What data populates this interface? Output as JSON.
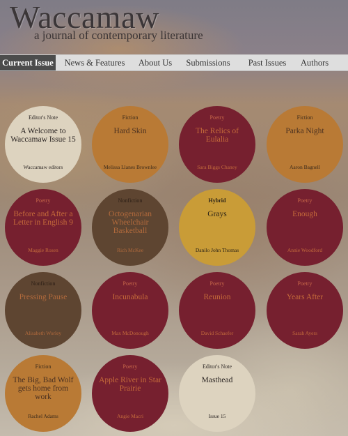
{
  "site": {
    "title": "Waccamaw",
    "tagline": "a journal of contemporary literature"
  },
  "nav": {
    "items": [
      "Current Issue",
      "News & Features",
      "About Us",
      "Submissions",
      "Past Issues",
      "Authors"
    ],
    "active": "Current Issue"
  },
  "colors": {
    "cream": "#ddd3bf",
    "orange": "#b97a35",
    "wine": "#76202f",
    "brown": "#5e4531",
    "mustard": "#c99c37",
    "nav_active": "#4c4c4c"
  },
  "pieces": [
    {
      "category": "Editor's Note",
      "title": "A Welcome to Waccamaw Issue 15",
      "author": "Waccamaw editors",
      "color": "cream"
    },
    {
      "category": "Fiction",
      "title": "Hard Skin",
      "author": "Melissa Llanes Brownlee",
      "color": "orange"
    },
    {
      "category": "Poetry",
      "title": "The Relics of Eulalia",
      "author": "Sara Biggs Chaney",
      "color": "wine"
    },
    {
      "category": "Fiction",
      "title": "Parka Night",
      "author": "Aaron Bagnell",
      "color": "orange"
    },
    {
      "category": "Poetry",
      "title": "Before and After a Letter in English 9",
      "author": "Maggie Rosen",
      "color": "wine"
    },
    {
      "category": "Nonfiction",
      "title": "Octogenarian Wheelchair Basketball",
      "author": "Rich McKee",
      "color": "brown"
    },
    {
      "category": "Hybrid",
      "title": "Grays",
      "author": "Danilo John Thomas",
      "color": "mustard"
    },
    {
      "category": "Poetry",
      "title": "Enough",
      "author": "Annie Woodford",
      "color": "wine"
    },
    {
      "category": "Nonfiction",
      "title": "Pressing Pause",
      "author": "Alisabeth Worley",
      "color": "brown"
    },
    {
      "category": "Poetry",
      "title": "Incunabula",
      "author": "Max McDonough",
      "color": "wine"
    },
    {
      "category": "Poetry",
      "title": "Reunion",
      "author": "David Schaefer",
      "color": "wine"
    },
    {
      "category": "Poetry",
      "title": "Years After",
      "author": "Sarah Ayers",
      "color": "wine"
    },
    {
      "category": "Fiction",
      "title": "The Big, Bad Wolf gets home from work",
      "author": "Rachel Adams",
      "color": "orange"
    },
    {
      "category": "Poetry",
      "title": "Apple River in Star Prairie",
      "author": "Angie Macri",
      "color": "wine"
    },
    {
      "category": "Editor's Note",
      "title": "Masthead",
      "author": "Issue 15",
      "color": "cream"
    }
  ]
}
